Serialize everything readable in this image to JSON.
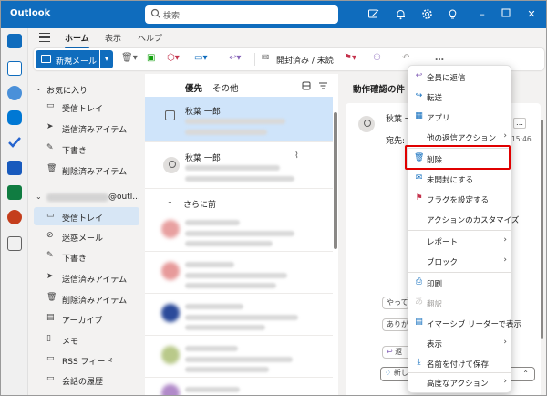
{
  "app": {
    "title": "Outlook"
  },
  "search": {
    "placeholder": "検索"
  },
  "ribbon": {
    "tabs": [
      "ホーム",
      "表示",
      "ヘルプ"
    ]
  },
  "toolbar": {
    "new_mail": "新規メール",
    "read_unread": "開封済み / 未読",
    "more": "…"
  },
  "folders": {
    "favorites_header": "お気に入り",
    "favorites": [
      "受信トレイ",
      "送信済みアイテム",
      "下書き",
      "削除済みアイテム"
    ],
    "account_suffix": "@outl...",
    "account_folders": [
      "受信トレイ",
      "迷惑メール",
      "下書き",
      "送信済みアイテム",
      "削除済みアイテム",
      "アーカイブ",
      "メモ",
      "RSS フィード",
      "会話の履歴"
    ]
  },
  "message_list": {
    "tabs": [
      "優先",
      "その他"
    ],
    "messages": [
      {
        "sender": "秋葉 一郎"
      },
      {
        "sender": "秋葉 一郎"
      }
    ],
    "section": "さらに前"
  },
  "reading_pane": {
    "subject": "動作確認の件",
    "sender": "秋葉 一",
    "to_label": "宛先:",
    "time": "15:46",
    "btn1": "やって",
    "btn2": "ありが",
    "reply": "返",
    "new_label": "新し"
  },
  "context_menu": {
    "items": [
      {
        "icon": "reply-all-icon",
        "label": "全員に返信"
      },
      {
        "icon": "forward-icon",
        "label": "転送"
      },
      {
        "icon": "apps-icon",
        "label": "アプリ"
      },
      {
        "icon": "none",
        "label": "他の返信アクション",
        "submenu": true
      },
      {
        "icon": "trash-icon",
        "label": "削除"
      },
      {
        "icon": "mail-icon",
        "label": "未開封にする"
      },
      {
        "icon": "flag-icon",
        "label": "フラグを設定する"
      },
      {
        "icon": "none",
        "label": "アクションのカスタマイズ"
      },
      {
        "icon": "none",
        "label": "レポート",
        "submenu": true
      },
      {
        "icon": "none",
        "label": "ブロック",
        "submenu": true
      },
      {
        "icon": "print-icon",
        "label": "印刷"
      },
      {
        "icon": "translate-icon",
        "label": "翻訳",
        "disabled": true
      },
      {
        "icon": "immersive-reader-icon",
        "label": "イマーシブ リーダーで表示"
      },
      {
        "icon": "none",
        "label": "表示",
        "submenu": true
      },
      {
        "icon": "download-icon",
        "label": "名前を付けて保存"
      },
      {
        "icon": "none",
        "label": "高度なアクション",
        "submenu": true
      }
    ]
  },
  "colors": {
    "brand": "#0f6cbd",
    "highlight": "#e00000",
    "selected": "#cfe4fa"
  }
}
